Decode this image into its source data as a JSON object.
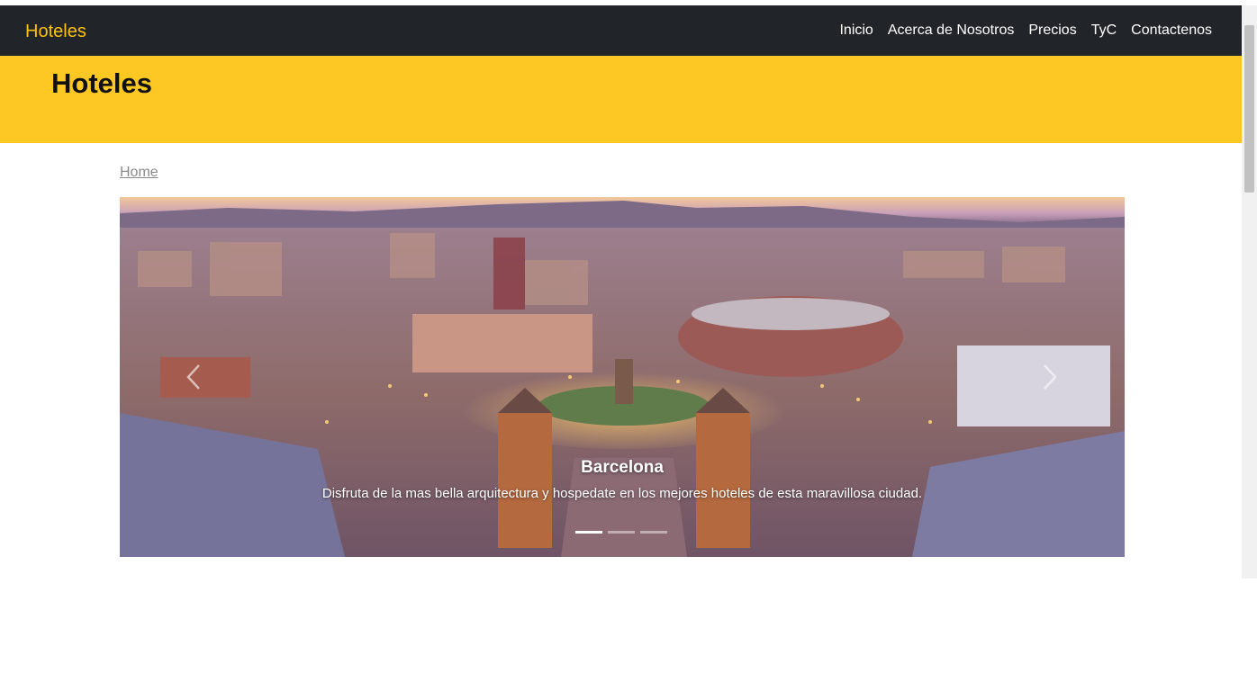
{
  "navbar": {
    "brand": "Hoteles",
    "links": [
      "Inicio",
      "Acerca de Nosotros",
      "Precios",
      "TyC",
      "Contactenos"
    ]
  },
  "hero": {
    "title": "Hoteles"
  },
  "breadcrumb": {
    "home": "Home"
  },
  "carousel": {
    "caption_title": "Barcelona",
    "caption_text": "Disfruta de la mas bella arquitectura y hospedate en los mejores hoteles de esta maravillosa ciudad.",
    "slides_count": 3,
    "active_slide": 1,
    "prev_icon": "chevron-left-icon",
    "next_icon": "chevron-right-icon"
  },
  "colors": {
    "navbar_bg": "#212529",
    "brand": "#ffc107",
    "hero_bg": "#fdc823"
  }
}
